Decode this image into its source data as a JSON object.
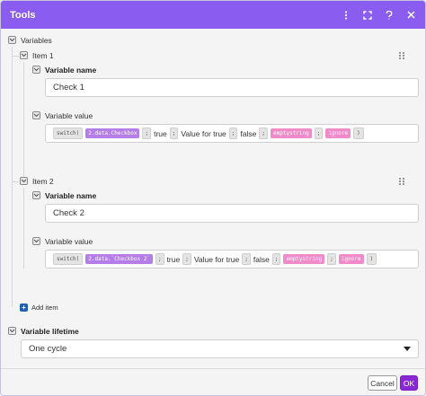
{
  "window": {
    "title": "Tools"
  },
  "titlebar_icons": [
    "more-vertical-icon",
    "expand-icon",
    "help-icon",
    "close-icon"
  ],
  "variables": {
    "label": "Variables",
    "items": [
      {
        "label": "Item 1",
        "name_label": "Variable name",
        "name_value": "Check 1",
        "value_label": "Variable value",
        "expression": [
          {
            "kind": "fn",
            "text": "switch("
          },
          {
            "kind": "v",
            "text": "2.data.Checkbox"
          },
          {
            "kind": "s",
            "text": ";"
          },
          {
            "kind": "t",
            "text": "true"
          },
          {
            "kind": "s",
            "text": ";"
          },
          {
            "kind": "t",
            "text": "Value for true"
          },
          {
            "kind": "s",
            "text": ";"
          },
          {
            "kind": "t",
            "text": "false"
          },
          {
            "kind": "s",
            "text": ";"
          },
          {
            "kind": "k",
            "text": "emptystring"
          },
          {
            "kind": "s",
            "text": ";"
          },
          {
            "kind": "k",
            "text": "ignore"
          },
          {
            "kind": "fn",
            "text": ")"
          }
        ]
      },
      {
        "label": "Item 2",
        "name_label": "Variable name",
        "name_value": "Check 2",
        "value_label": "Variable value",
        "expression": [
          {
            "kind": "fn",
            "text": "switch("
          },
          {
            "kind": "v",
            "text": "2.data.`Checkbox 2`"
          },
          {
            "kind": "s",
            "text": ";"
          },
          {
            "kind": "t",
            "text": "true"
          },
          {
            "kind": "s",
            "text": ";"
          },
          {
            "kind": "t",
            "text": "Value for true"
          },
          {
            "kind": "s",
            "text": ";"
          },
          {
            "kind": "t",
            "text": "false"
          },
          {
            "kind": "s",
            "text": ";"
          },
          {
            "kind": "k",
            "text": "emptystring"
          },
          {
            "kind": "s",
            "text": ";"
          },
          {
            "kind": "k",
            "text": "ignore"
          },
          {
            "kind": "fn",
            "text": ")"
          }
        ]
      }
    ],
    "add_item_label": "Add item"
  },
  "lifetime": {
    "label": "Variable lifetime",
    "selected": "One cycle"
  },
  "footer": {
    "cancel_label": "Cancel",
    "ok_label": "OK"
  },
  "colors": {
    "titlebar": "#8b5cf0",
    "ok_button": "#8b28d6",
    "variable_token": "#b57de8",
    "keyword_token": "#f08ac8",
    "add_icon": "#1d5fb5"
  }
}
